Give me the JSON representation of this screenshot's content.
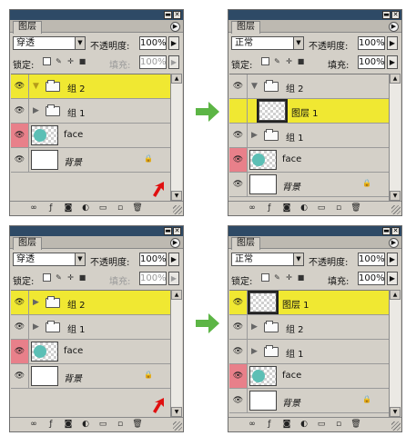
{
  "colors": {
    "highlight": "#f0e832",
    "eye_red": "#e8808a",
    "green_arrow": "#5cb545",
    "red_arrow": "#e01010",
    "face_dot": "#5cbfb5"
  },
  "panels": [
    {
      "tab": "图层",
      "blend_mode": "穿透",
      "opacity_label": "不透明度:",
      "opacity": "100%",
      "lock_label": "锁定:",
      "fill_label": "填充:",
      "fill": "100%",
      "fill_dim": true,
      "layers": [
        {
          "kind": "group",
          "name": "组 2",
          "expanded": true,
          "selected": true,
          "eye": "normal"
        },
        {
          "kind": "group",
          "name": "组 1",
          "expanded": false,
          "selected": false,
          "eye": "normal"
        },
        {
          "kind": "layer",
          "name": "face",
          "thumb": "face",
          "selected": false,
          "eye": "red"
        },
        {
          "kind": "layer",
          "name": "背景",
          "thumb": "white",
          "italic": true,
          "locked": true,
          "selected": false,
          "eye": "normal"
        }
      ]
    },
    {
      "tab": "图层",
      "blend_mode": "正常",
      "opacity_label": "不透明度:",
      "opacity": "100%",
      "lock_label": "锁定:",
      "fill_label": "填充:",
      "fill": "100%",
      "fill_dim": false,
      "layers": [
        {
          "kind": "group",
          "name": "组 2",
          "expanded": true,
          "selected": false,
          "eye": "normal"
        },
        {
          "kind": "layer",
          "name": "图层 1",
          "thumb": "checker",
          "child": true,
          "selected": true,
          "eye": "blank"
        },
        {
          "kind": "group",
          "name": "组 1",
          "expanded": false,
          "selected": false,
          "eye": "normal"
        },
        {
          "kind": "layer",
          "name": "face",
          "thumb": "face",
          "selected": false,
          "eye": "red"
        },
        {
          "kind": "layer",
          "name": "背景",
          "thumb": "white",
          "italic": true,
          "locked": true,
          "selected": false,
          "eye": "normal"
        }
      ]
    },
    {
      "tab": "图层",
      "blend_mode": "穿透",
      "opacity_label": "不透明度:",
      "opacity": "100%",
      "lock_label": "锁定:",
      "fill_label": "填充:",
      "fill": "100%",
      "fill_dim": true,
      "layers": [
        {
          "kind": "group",
          "name": "组 2",
          "expanded": false,
          "selected": true,
          "eye": "normal"
        },
        {
          "kind": "group",
          "name": "组 1",
          "expanded": false,
          "selected": false,
          "eye": "normal"
        },
        {
          "kind": "layer",
          "name": "face",
          "thumb": "face",
          "selected": false,
          "eye": "red"
        },
        {
          "kind": "layer",
          "name": "背景",
          "thumb": "white",
          "italic": true,
          "locked": true,
          "selected": false,
          "eye": "normal"
        }
      ]
    },
    {
      "tab": "图层",
      "blend_mode": "正常",
      "opacity_label": "不透明度:",
      "opacity": "100%",
      "lock_label": "锁定:",
      "fill_label": "填充:",
      "fill": "100%",
      "fill_dim": false,
      "layers": [
        {
          "kind": "layer",
          "name": "图层 1",
          "thumb": "checker",
          "selected": true,
          "eye": "normal"
        },
        {
          "kind": "group",
          "name": "组 2",
          "expanded": false,
          "selected": false,
          "eye": "normal"
        },
        {
          "kind": "group",
          "name": "组 1",
          "expanded": false,
          "selected": false,
          "eye": "normal"
        },
        {
          "kind": "layer",
          "name": "face",
          "thumb": "face",
          "selected": false,
          "eye": "red"
        },
        {
          "kind": "layer",
          "name": "背景",
          "thumb": "white",
          "italic": true,
          "locked": true,
          "selected": false,
          "eye": "normal"
        }
      ]
    }
  ]
}
